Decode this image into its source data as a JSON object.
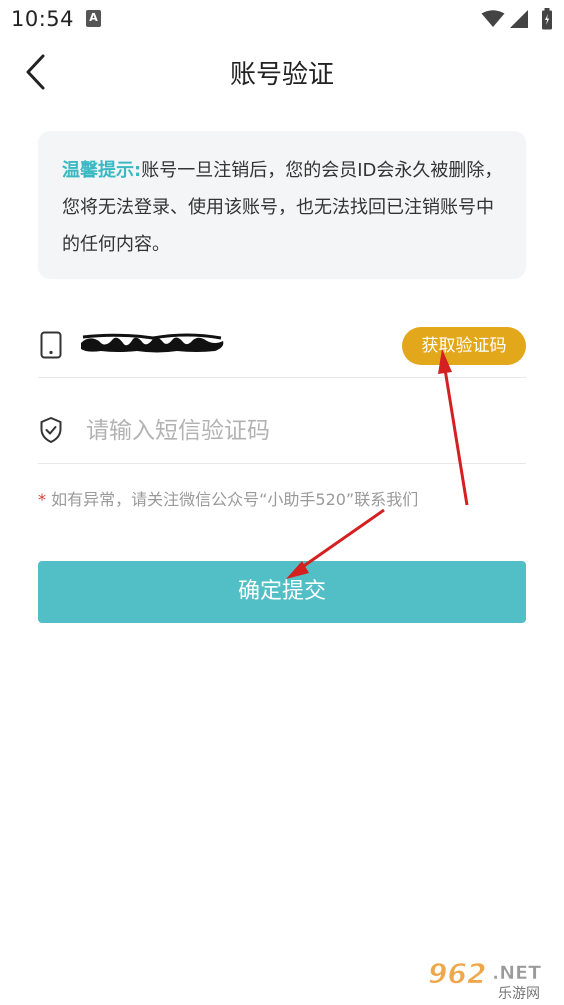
{
  "status_bar": {
    "time": "10:54",
    "notification_badge": "A",
    "icons": [
      "wifi-icon",
      "signal-icon",
      "battery-icon"
    ]
  },
  "header": {
    "back_icon": "chevron-left-icon",
    "title": "账号验证"
  },
  "notice": {
    "label": "温馨提示:",
    "text": "账号一旦注销后，您的会员ID会永久被删除，您将无法登录、使用该账号，也无法找回已注销账号中的任何内容。"
  },
  "phone": {
    "icon": "phone-icon",
    "value_redacted": true,
    "get_code_label": "获取验证码"
  },
  "code": {
    "icon": "shield-icon",
    "placeholder": "请输入短信验证码",
    "value": ""
  },
  "tip": {
    "star": "*",
    "text": "如有异常，请关注微信公众号“小助手520”联系我们"
  },
  "submit": {
    "label": "确定提交"
  },
  "watermark": {
    "brand_number": "962",
    "brand_suffix": ".NET",
    "brand_sub": "乐游网"
  },
  "colors": {
    "accent": "#52bfc7",
    "notice_label": "#3bb9c3",
    "get_code_button": "#e2a71a",
    "annotation_arrow": "#d42020",
    "tip_star": "#e03a3a"
  }
}
